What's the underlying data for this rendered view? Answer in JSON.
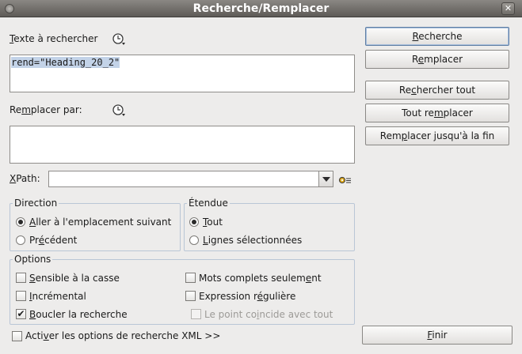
{
  "window": {
    "title": "Recherche/Remplacer",
    "close_glyph": "✕"
  },
  "search": {
    "label_pre": "",
    "label_mn": "T",
    "label_post": "exte à rechercher",
    "value": "rend=\"Heading_20_2\""
  },
  "replace": {
    "label_pre": "Re",
    "label_mn": "m",
    "label_post": "placer par:",
    "value": ""
  },
  "xpath": {
    "label_pre": "",
    "label_mn": "X",
    "label_post": "Path:",
    "value": ""
  },
  "direction": {
    "title": "Direction",
    "options": [
      {
        "pre": "",
        "mn": "A",
        "post": "ller à l'emplacement suivant",
        "selected": true
      },
      {
        "pre": "Pr",
        "mn": "é",
        "post": "cédent",
        "selected": false
      }
    ]
  },
  "scope": {
    "title": "Étendue",
    "options": [
      {
        "pre": "",
        "mn": "T",
        "post": "out",
        "selected": true
      },
      {
        "pre": "",
        "mn": "L",
        "post": "ignes sélectionnées",
        "selected": false
      }
    ]
  },
  "options": {
    "title": "Options",
    "items": [
      {
        "pre": "",
        "mn": "S",
        "post": "ensible à la casse",
        "checked": false,
        "check_glyph": ""
      },
      {
        "pre": "Mots complets seulem",
        "mn": "e",
        "post": "nt",
        "checked": false,
        "check_glyph": ""
      },
      {
        "pre": "",
        "mn": "I",
        "post": "ncrémental",
        "checked": false,
        "check_glyph": ""
      },
      {
        "pre": "Expression r",
        "mn": "é",
        "post": "gulière",
        "checked": false,
        "check_glyph": ""
      },
      {
        "pre": "",
        "mn": "B",
        "post": "oucler la recherche",
        "checked": true,
        "check_glyph": "✔"
      },
      {
        "pre": "Le point co",
        "mn": "i",
        "post": "ncide avec tout",
        "checked": false,
        "disabled": true,
        "check_glyph": ""
      }
    ]
  },
  "xml_options": {
    "pre": "Acti",
    "mn": "v",
    "post": "er les options de recherche XML >>",
    "checked": false,
    "check_glyph": ""
  },
  "buttons": {
    "search": {
      "pre": "",
      "mn": "R",
      "post": "echerche"
    },
    "replace": {
      "pre": "R",
      "mn": "e",
      "post": "mplacer"
    },
    "find_all": {
      "pre": "Re",
      "mn": "c",
      "post": "hercher tout"
    },
    "replace_all": {
      "pre": "Tout re",
      "mn": "m",
      "post": "placer"
    },
    "replace_to_end": {
      "pre": "Rem",
      "mn": "p",
      "post": "lacer jusqu'à la fin"
    },
    "close": {
      "pre": "",
      "mn": "F",
      "post": "inir"
    }
  },
  "icons": {
    "history": "history-icon",
    "xpath_settings": "gear-icon",
    "dropdown": "chevron-down-icon"
  },
  "colors": {
    "selection": "#c3d3e8",
    "group_border": "#b9c6d6",
    "default_button_border": "#5f7ea4"
  }
}
